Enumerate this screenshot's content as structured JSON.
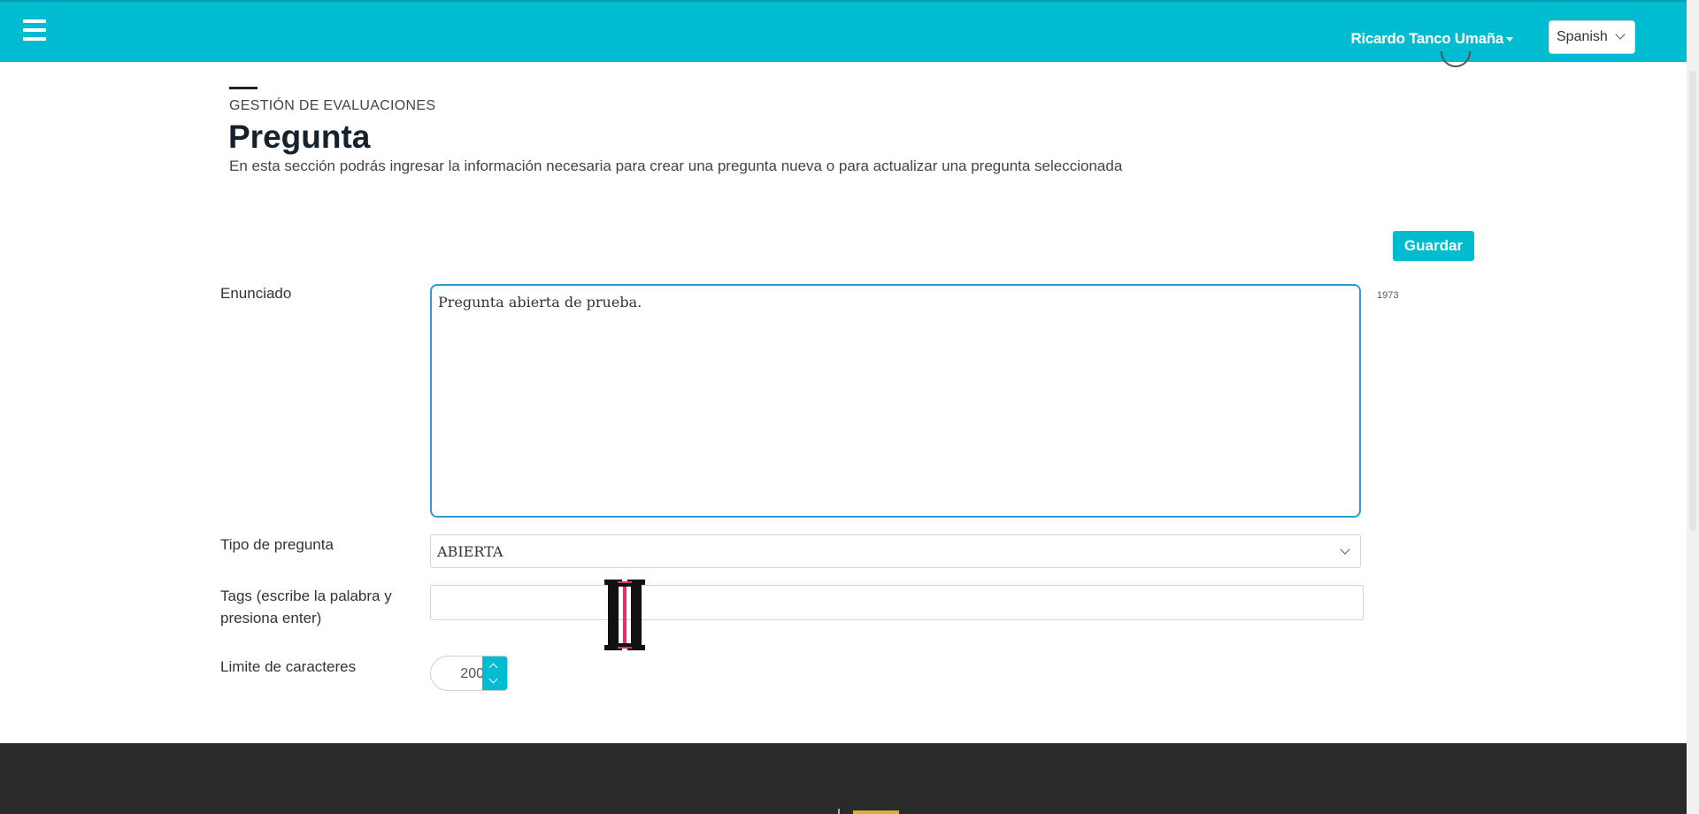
{
  "topbar": {
    "menu_icon": "hamburger-menu-icon",
    "user_name": "Ricardo Tanco Umaña",
    "language": "Spanish",
    "accent_color": "#00bcd0"
  },
  "header": {
    "section": "GESTIÓN DE EVALUACIONES",
    "title": "Pregunta",
    "description": "En esta sección podrás ingresar la información necesaria para crear una pregunta nueva o para actualizar una pregunta seleccionada"
  },
  "actions": {
    "save_label": "Guardar"
  },
  "form": {
    "statement": {
      "label": "Enunciado",
      "value": "Pregunta abierta de prueba.",
      "char_count": "1973"
    },
    "question_type": {
      "label": "Tipo de pregunta",
      "value": "ABIERTA"
    },
    "tags": {
      "label": "Tags (escribe la palabra y presiona enter)",
      "value": ""
    },
    "char_limit": {
      "label": "Limite de caracteres",
      "value": "200"
    }
  }
}
